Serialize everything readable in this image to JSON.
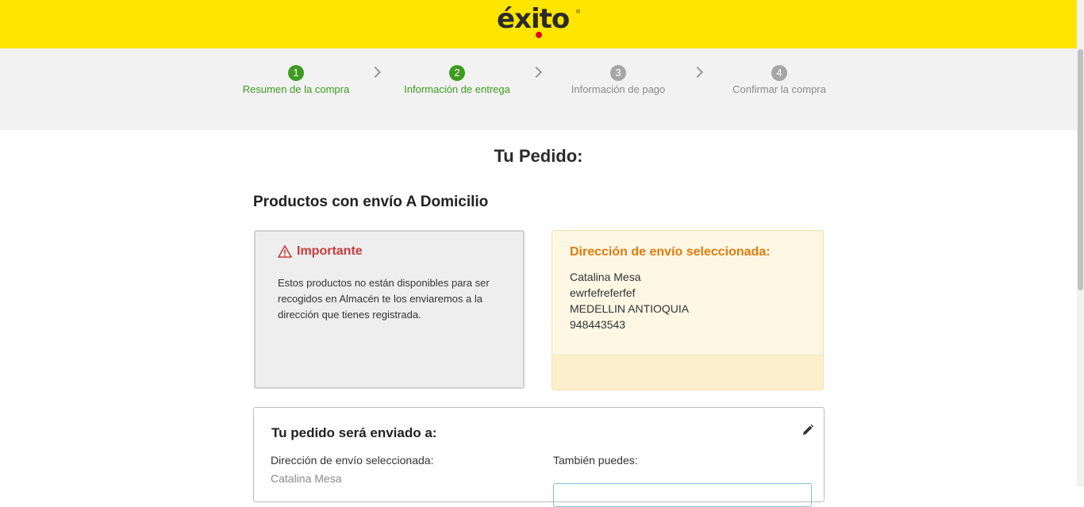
{
  "brand": {
    "logo": "éxito",
    "reg": "®"
  },
  "steps": [
    {
      "number": "1",
      "label": "Resumen de la compra",
      "state": "done"
    },
    {
      "number": "2",
      "label": "Información de entrega",
      "state": "done"
    },
    {
      "number": "3",
      "label": "Información de pago",
      "state": "todo"
    },
    {
      "number": "4",
      "label": "Confirmar la compra",
      "state": "todo"
    }
  ],
  "page": {
    "title": "Tu Pedido:",
    "section_title": "Productos con envío A Domicilio"
  },
  "important": {
    "heading": "Importante",
    "icon": "warning-icon",
    "text": "Estos productos no están disponibles para ser recogidos en Almacén te los enviaremos a la dirección que tienes registrada."
  },
  "address": {
    "heading": "Dirección de envío seleccionada:",
    "lines": [
      "Catalina Mesa",
      "ewrfefreferfef",
      "MEDELLIN ANTIOQUIA",
      "948443543"
    ]
  },
  "shipping": {
    "heading": "Tu pedido será enviado a:",
    "edit_icon": "pencil-icon",
    "left_label": "Dirección de envío seleccionada:",
    "left_value": "Catalina Mesa",
    "right_label": "También puedes:"
  },
  "colors": {
    "topbar": "#ffe500",
    "step_done": "#3d9b1f",
    "step_todo": "#a6a6a6",
    "important_heading": "#c73b3b",
    "address_heading": "#e07b10"
  }
}
